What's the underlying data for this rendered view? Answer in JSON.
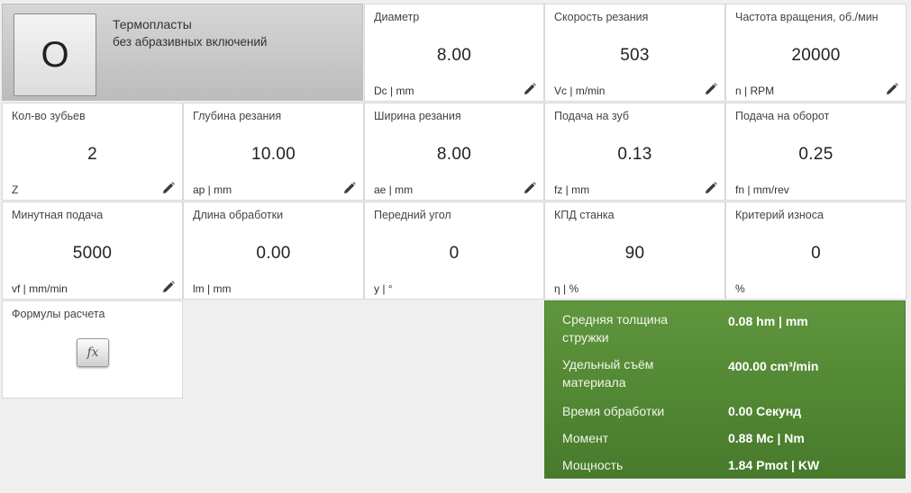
{
  "material": {
    "code": "O",
    "name": "Термопласты",
    "subtitle": "без абразивных включений"
  },
  "params": [
    {
      "label": "Диаметр",
      "value": "8.00",
      "unit": "Dc | mm",
      "editable": true
    },
    {
      "label": "Скорость резания",
      "value": "503",
      "unit": "Vc | m/min",
      "editable": true
    },
    {
      "label": "Частота вращения, об./мин",
      "value": "20000",
      "unit": "n | RPM",
      "editable": true
    },
    {
      "label": "Кол-во зубьев",
      "value": "2",
      "unit": "Z",
      "editable": true
    },
    {
      "label": "Глубина резания",
      "value": "10.00",
      "unit": "ap | mm",
      "editable": true
    },
    {
      "label": "Ширина резания",
      "value": "8.00",
      "unit": "ae | mm",
      "editable": true
    },
    {
      "label": "Подача на зуб",
      "value": "0.13",
      "unit": "fz | mm",
      "editable": true
    },
    {
      "label": "Подача на оборот",
      "value": "0.25",
      "unit": "fn | mm/rev",
      "editable": false
    },
    {
      "label": "Минутная подача",
      "value": "5000",
      "unit": "vf | mm/min",
      "editable": true
    },
    {
      "label": "Длина обработки",
      "value": "0.00",
      "unit": "lm | mm",
      "editable": false
    },
    {
      "label": "Передний угол",
      "value": "0",
      "unit": "y | °",
      "editable": false
    },
    {
      "label": "КПД станка",
      "value": "90",
      "unit": "η | %",
      "editable": false
    },
    {
      "label": "Критерий износа",
      "value": "0",
      "unit": "%",
      "editable": false
    }
  ],
  "formulas": {
    "label": "Формулы расчета",
    "button": "fx"
  },
  "results": [
    {
      "label": "Средняя толщина стружки",
      "value": "0.08 hm | mm"
    },
    {
      "label": "Удельный съём материала",
      "value": "400.00 cm³/min"
    },
    {
      "label": "Время обработки",
      "value": "0.00 Секунд"
    },
    {
      "label": "Момент",
      "value": "0.88 Mc | Nm"
    },
    {
      "label": "Мощность",
      "value": "1.84 Pmot | KW"
    }
  ],
  "icons": {
    "edit": "pencil-icon",
    "formula": "fx-icon"
  },
  "colors": {
    "results_bg": "#528a35",
    "material_bg": "#c8c8c8",
    "tile_bg": "#ffffff",
    "page_bg": "#efefef"
  }
}
